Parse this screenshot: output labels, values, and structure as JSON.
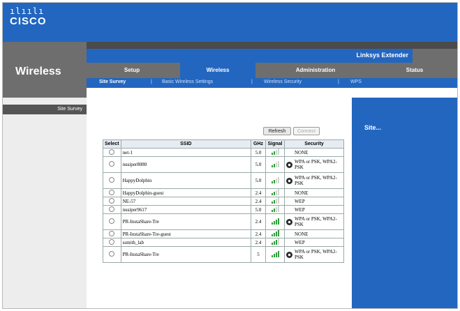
{
  "brand": {
    "name": "CISCO",
    "mark": "ılıılı"
  },
  "section_title": "Wireless",
  "product_name": "Linksys Extender",
  "nav": {
    "tabs": [
      {
        "label": "Setup",
        "active": false
      },
      {
        "label": "Wireless",
        "active": true
      },
      {
        "label": "Administration",
        "active": false
      },
      {
        "label": "Status",
        "active": false
      }
    ],
    "subtabs": [
      {
        "label": "Site Survey",
        "active": true
      },
      {
        "label": "Basic Wireless Settings",
        "active": false
      },
      {
        "label": "Wireless Security",
        "active": false
      },
      {
        "label": "WPS",
        "active": false
      }
    ],
    "separator": "|"
  },
  "sidebar": {
    "current_item": "Site Survey"
  },
  "buttons": {
    "refresh": "Refresh",
    "connect": "Connect"
  },
  "table": {
    "headers": {
      "select": "Select",
      "ssid": "SSID",
      "ghz": "GHz",
      "signal": "Signal",
      "security": "Security"
    },
    "rows": [
      {
        "ssid": "net-1",
        "ghz": "5.0",
        "signal": 2,
        "security": "NONE",
        "locked": false
      },
      {
        "ssid": "nusiper8080",
        "ghz": "5.0",
        "signal": 2,
        "security": "WPA or PSK, WPA2-PSK",
        "locked": true
      },
      {
        "ssid": "HappyDolphin",
        "ghz": "5.0",
        "signal": 2,
        "security": "WPA or PSK, WPA2-PSK",
        "locked": true
      },
      {
        "ssid": "HappyDolphin-guest",
        "ghz": "2.4",
        "signal": 2,
        "security": "NONE",
        "locked": false
      },
      {
        "ssid": "NE-57",
        "ghz": "2.4",
        "signal": 2,
        "security": "WEP",
        "locked": false
      },
      {
        "ssid": "nusiper9617",
        "ghz": "5.0",
        "signal": 2,
        "security": "WEP",
        "locked": false
      },
      {
        "ssid": "PR-InstaShare-Tre",
        "ghz": "2.4",
        "signal": 4,
        "security": "WPA or PSK, WPA2-PSK",
        "locked": true
      },
      {
        "ssid": "PR-InstaShare-Tre-guest",
        "ghz": "2.4",
        "signal": 4,
        "security": "NONE",
        "locked": false
      },
      {
        "ssid": "ssmith_lab",
        "ghz": "2.4",
        "signal": 3,
        "security": "WEP",
        "locked": false
      },
      {
        "ssid": "PR-InstaShare-Tre",
        "ghz": "5",
        "signal": 4,
        "security": "WPA or PSK, WPA2-PSK",
        "locked": true
      }
    ]
  },
  "help": {
    "title": "Site..."
  }
}
